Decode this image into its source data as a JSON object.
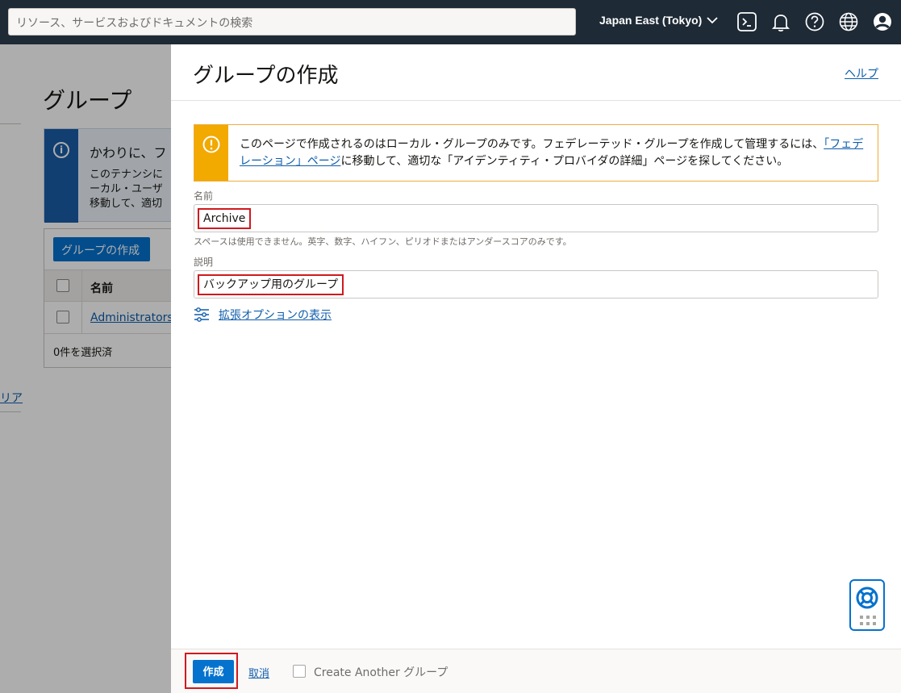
{
  "topbar": {
    "search_placeholder": "リソース、サービスおよびドキュメントの検索",
    "region": "Japan East (Tokyo)",
    "icons": [
      "cloud-shell-icon",
      "bell-icon",
      "help-icon",
      "globe-icon",
      "user-icon"
    ]
  },
  "background": {
    "title": "グループ",
    "info_heading": "かわりに、フ",
    "info_lines": [
      "このテナンシに",
      "ーカル・ユーザ",
      "移動して、適切"
    ],
    "create_button": "グループの作成",
    "column_name": "名前",
    "rows": [
      {
        "name": "Administrators"
      }
    ],
    "selected_count": "0件を選択済",
    "side_link": "リア"
  },
  "drawer": {
    "title": "グループの作成",
    "help_link": "ヘルプ",
    "warning": {
      "text_before": "このページで作成されるのはローカル・グループのみです。フェデレーテッド・グループを作成して管理するには、",
      "link": "「フェデレーション」ページ",
      "text_after": "に移動して、適切な「アイデンティティ・プロバイダの詳細」ページを探してください。"
    },
    "name_label": "名前",
    "name_value": "Archive",
    "name_hint": "スペースは使用できません。英字、数字、ハイフン、ピリオドまたはアンダースコアのみです。",
    "description_label": "説明",
    "description_value": "バックアップ用のグループ",
    "advanced_link": "拡張オプションの表示",
    "footer": {
      "create_button": "作成",
      "cancel_link": "取消",
      "create_another_label": "Create Another グループ"
    }
  },
  "colors": {
    "topbar": "#1e2a36",
    "primary": "#0572ce",
    "link": "#0f5dab",
    "warning": "#f2a900",
    "highlight": "#d0191e"
  }
}
